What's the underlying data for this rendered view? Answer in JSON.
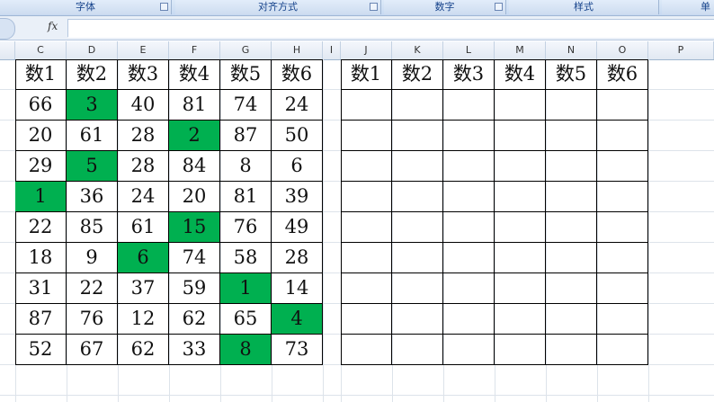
{
  "ribbon": {
    "groups": [
      {
        "label": "字体"
      },
      {
        "label": "对齐方式"
      },
      {
        "label": "数字"
      },
      {
        "label": "样式"
      },
      {
        "label": "单"
      }
    ]
  },
  "formula_bar": {
    "fx_label": "fx",
    "value": ""
  },
  "columns": [
    "C",
    "D",
    "E",
    "F",
    "G",
    "H",
    "I",
    "J",
    "K",
    "L",
    "M",
    "N",
    "O",
    "P"
  ],
  "left_table": {
    "headers": [
      "数1",
      "数2",
      "数3",
      "数4",
      "数5",
      "数6"
    ],
    "rows": [
      [
        "66",
        "3",
        "40",
        "81",
        "74",
        "24"
      ],
      [
        "20",
        "61",
        "28",
        "2",
        "87",
        "50"
      ],
      [
        "29",
        "5",
        "28",
        "84",
        "8",
        "6"
      ],
      [
        "1",
        "36",
        "24",
        "20",
        "81",
        "39"
      ],
      [
        "22",
        "85",
        "61",
        "15",
        "76",
        "49"
      ],
      [
        "18",
        "9",
        "6",
        "74",
        "58",
        "28"
      ],
      [
        "31",
        "22",
        "37",
        "59",
        "1",
        "14"
      ],
      [
        "87",
        "76",
        "12",
        "62",
        "65",
        "4"
      ],
      [
        "52",
        "67",
        "62",
        "33",
        "8",
        "73"
      ]
    ],
    "highlight": [
      [
        0,
        1
      ],
      [
        1,
        3
      ],
      [
        2,
        1
      ],
      [
        3,
        0
      ],
      [
        4,
        3
      ],
      [
        5,
        2
      ],
      [
        6,
        4
      ],
      [
        7,
        5
      ],
      [
        8,
        4
      ]
    ],
    "highlight_color": "#00b050"
  },
  "right_table": {
    "headers": [
      "数1",
      "数2",
      "数3",
      "数4",
      "数5",
      "数6"
    ],
    "rows": [
      [
        "",
        "",
        "",
        "",
        "",
        ""
      ],
      [
        "",
        "",
        "",
        "",
        "",
        ""
      ],
      [
        "",
        "",
        "",
        "",
        "",
        ""
      ],
      [
        "",
        "",
        "",
        "",
        "",
        ""
      ],
      [
        "",
        "",
        "",
        "",
        "",
        ""
      ],
      [
        "",
        "",
        "",
        "",
        "",
        ""
      ],
      [
        "",
        "",
        "",
        "",
        "",
        ""
      ],
      [
        "",
        "",
        "",
        "",
        "",
        ""
      ],
      [
        "",
        "",
        "",
        "",
        "",
        ""
      ]
    ]
  }
}
